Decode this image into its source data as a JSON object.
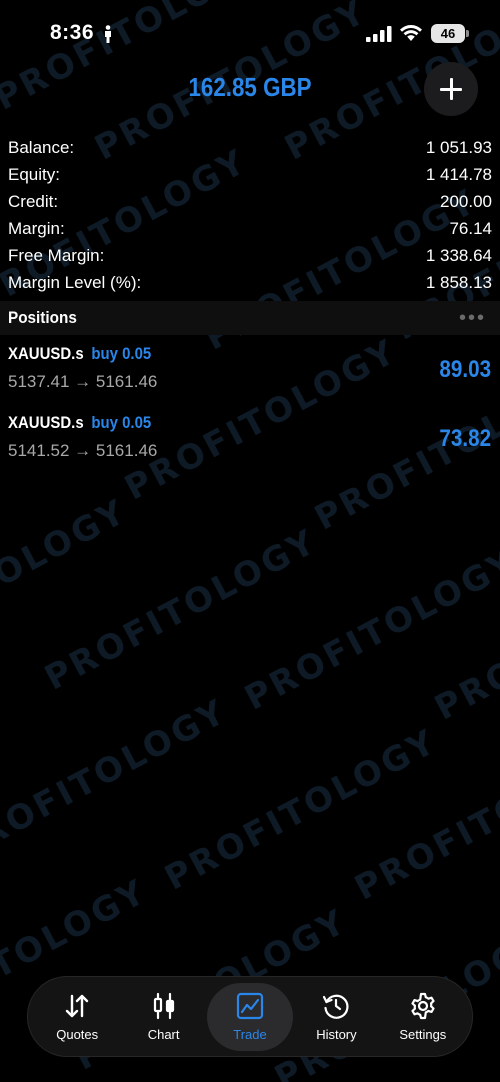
{
  "status_bar": {
    "time": "8:36",
    "battery": "46"
  },
  "header": {
    "profit_label": "162.85 GBP"
  },
  "account": [
    {
      "label": "Balance:",
      "value": "1 051.93"
    },
    {
      "label": "Equity:",
      "value": "1 414.78"
    },
    {
      "label": "Credit:",
      "value": "200.00"
    },
    {
      "label": "Margin:",
      "value": "76.14"
    },
    {
      "label": "Free Margin:",
      "value": "1 338.64"
    },
    {
      "label": "Margin Level (%):",
      "value": "1 858.13"
    }
  ],
  "positions": {
    "title": "Positions",
    "items": [
      {
        "symbol": "XAUUSD.s",
        "side": "buy 0.05",
        "prices": "5137.41 → 5161.46",
        "profit": "89.03"
      },
      {
        "symbol": "XAUUSD.s",
        "side": "buy 0.05",
        "prices": "5141.52 → 5161.46",
        "profit": "73.82"
      }
    ]
  },
  "tabs": [
    {
      "label": "Quotes",
      "icon": "quotes-arrows-icon",
      "active": false
    },
    {
      "label": "Chart",
      "icon": "candlestick-icon",
      "active": false
    },
    {
      "label": "Trade",
      "icon": "trade-chart-icon",
      "active": true
    },
    {
      "label": "History",
      "icon": "history-clock-icon",
      "active": false
    },
    {
      "label": "Settings",
      "icon": "gear-icon",
      "active": false
    }
  ],
  "watermark": "PROFITOLOGY",
  "colors": {
    "accent": "#2a86e8",
    "background": "#000000",
    "tab_bar": "#141414"
  }
}
